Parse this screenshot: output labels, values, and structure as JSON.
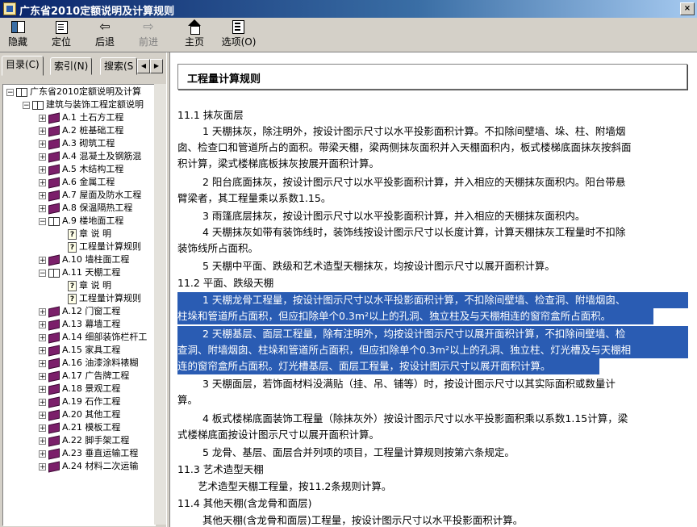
{
  "window": {
    "title": "广东省2010定额说明及计算规则",
    "close_label": "×"
  },
  "toolbar": {
    "hide": "隐藏",
    "locate": "定位",
    "back": "后退",
    "forward": "前进",
    "home": "主页",
    "options": "选项(O)"
  },
  "tabs": {
    "contents": "目录(C)",
    "index": "索引(N)",
    "search": "搜索(S"
  },
  "tree": {
    "root": "广东省2010定额说明及计算",
    "group": "建筑与装饰工程定额说明",
    "items": [
      "A.1 土石方工程",
      "A.2 桩基础工程",
      "A.3 砌筑工程",
      "A.4 混凝土及钢筋混",
      "A.5 木结构工程",
      "A.6 金属工程",
      "A.7 屋面及防水工程",
      "A.8 保温隔热工程",
      "A.9 楼地面工程",
      "章 说 明",
      "工程量计算规则",
      "A.10 墙柱面工程",
      "A.11 天棚工程",
      "章 说 明",
      "工程量计算规则",
      "A.12 门窗工程",
      "A.13 幕墙工程",
      "A.14 细部装饰栏杆工",
      "A.15 家具工程",
      "A.16 油漆涂料裱糊",
      "A.17 广告牌工程",
      "A.18 景观工程",
      "A.19 石作工程",
      "A.20 其他工程",
      "A.21 模板工程",
      "A.22 脚手架工程",
      "A.23 垂直运输工程",
      "A.24 材料二次运输"
    ]
  },
  "content": {
    "heading": "工程量计算规则",
    "lines": [
      "11.1  抹灰面层",
      "1  天棚抹灰，除注明外，按设计图示尺寸以水平投影面积计算。不扣除间壁墙、垛、柱、附墙烟",
      "囱、检查口和管道所占的面积。带梁天棚，梁两侧抹灰面积并入天棚面积内，板式楼梯底面抹灰按斜面",
      "积计算，梁式楼梯底板抹灰按展开面积计算。",
      "2  阳台底面抹灰，按设计图示尺寸以水平投影面积计算，并入相应的天棚抹灰面积内。阳台带悬",
      "臂梁者，其工程量乘以系数1.15。",
      "3  雨篷底层抹灰，按设计图示尺寸以水平投影面积计算，并入相应的天棚抹灰面积内。",
      "4  天棚抹灰如带有装饰线时，装饰线按设计图示尺寸以长度计算，计算天棚抹灰工程量时不扣除",
      "装饰线所占面积。",
      "5  天棚中平面、跌级和艺术造型天棚抹灰，均按设计图示尺寸以展开面积计算。",
      "11.2  平面、跌级天棚",
      "1  天棚龙骨工程量，按设计图示尺寸以水平投影面积计算，不扣除间壁墙、检查洞、附墙烟囱、",
      "柱垛和管道所占面积，但应扣除单个0.3m²以上的孔洞、独立柱及与天棚相连的窗帘盒所占面积。",
      "2  天棚基层、面层工程量，除有注明外，均按设计图示尺寸以展开面积计算，不扣除间壁墙、检",
      "查洞、附墙烟囱、柱垛和管道所占面积，但应扣除单个0.3m²以上的孔洞、独立柱、灯光槽及与天棚相",
      "连的窗帘盒所占面积。灯光槽基层、面层工程量，按设计图示尺寸以展开面积计算。",
      "3  天棚面层，若饰面材料没满贴（挂、吊、铺等）时，按设计图示尺寸以其实际面积或数量计",
      "算。",
      "4  板式楼梯底面装饰工程量（除抹灰外）按设计图示尺寸以水平投影面积乘以系数1.15计算，梁",
      "式楼梯底面按设计图示尺寸以展开面积计算。",
      "5  龙骨、基层、面层合并列项的项目，工程量计算规则按第六条规定。",
      "11.3  艺术造型天棚",
      "艺术造型天棚工程量，按11.2条规则计算。",
      "11.4  其他天棚(含龙骨和面层)",
      "其他天棚(含龙骨和面层)工程量，按设计图示尺寸以水平投影面积计算。"
    ]
  },
  "colors": {
    "title_bar": "#0a246a",
    "selection": "#2a5cb3",
    "book_closed": "#7b1f6a"
  }
}
